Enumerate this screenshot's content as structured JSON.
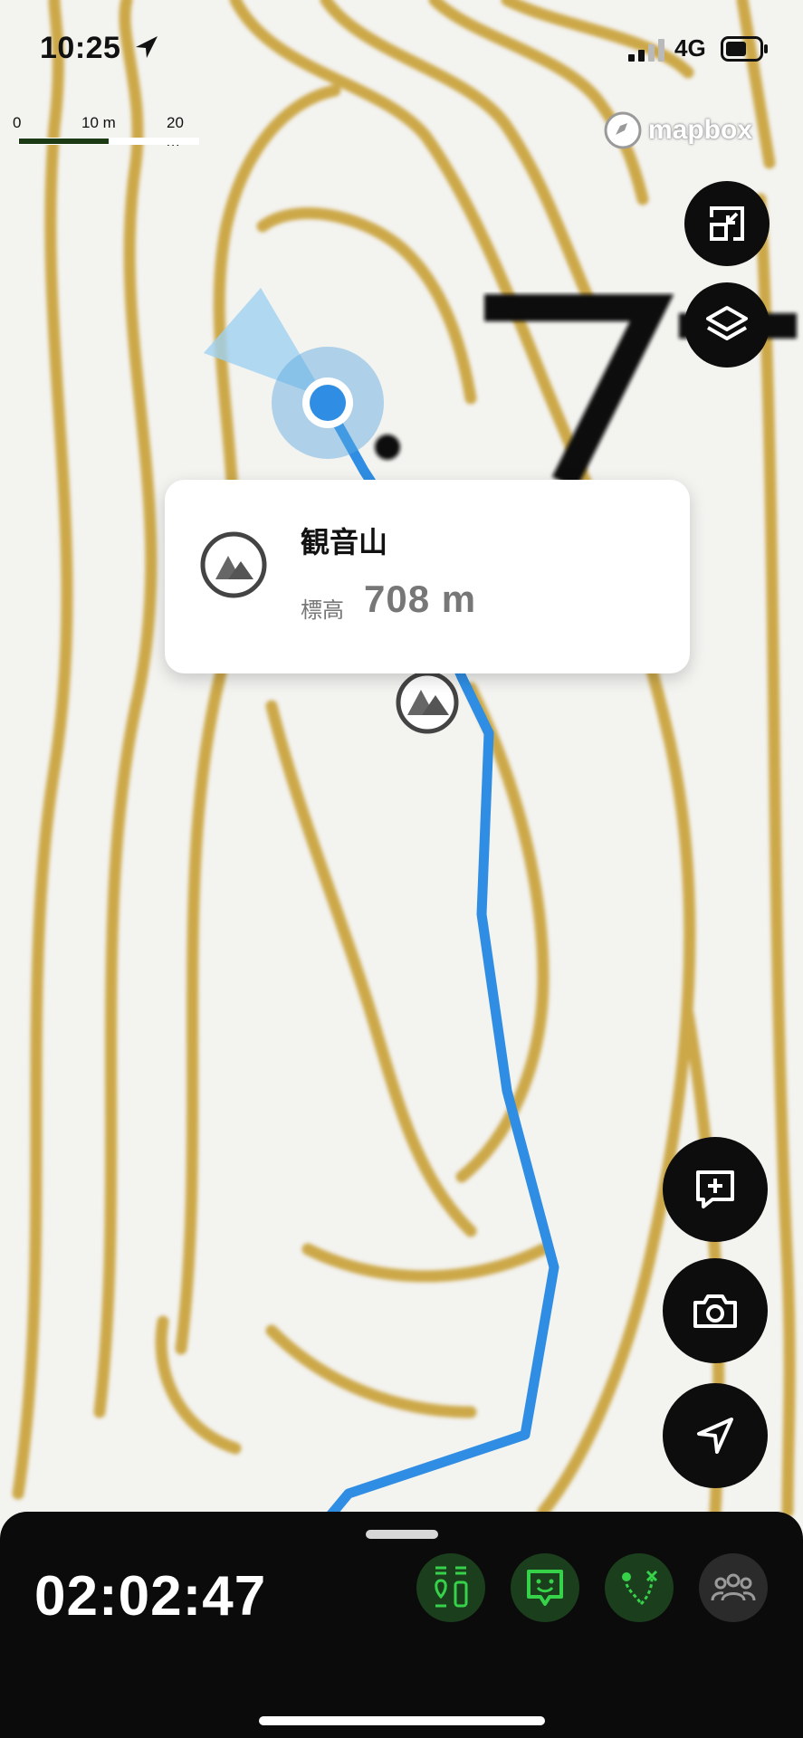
{
  "status_bar": {
    "time": "10:25",
    "network": "4G"
  },
  "map": {
    "scale": {
      "labels": [
        "0",
        "10 m",
        "20 m"
      ]
    },
    "attribution": "mapbox",
    "contour_label": "7"
  },
  "right_controls": {
    "top": [
      {
        "name": "expand-map-button",
        "icon": "expand-square-icon"
      },
      {
        "name": "layers-button",
        "icon": "layers-icon"
      }
    ],
    "bottom": [
      {
        "name": "add-note-button",
        "icon": "add-note-icon"
      },
      {
        "name": "camera-button",
        "icon": "camera-icon"
      },
      {
        "name": "locate-button",
        "icon": "navigation-arrow-icon"
      }
    ]
  },
  "poi_popup": {
    "name": "観音山",
    "elevation_label": "標高",
    "elevation_value": "708 m",
    "icon": "mountain-icon"
  },
  "bottom_panel": {
    "elapsed_time": "02:02:47",
    "buttons": [
      {
        "name": "waypoints-button",
        "icon": "waypoints-icon",
        "color": "#36d24a"
      },
      {
        "name": "chat-button",
        "icon": "chat-face-icon",
        "color": "#36d24a"
      },
      {
        "name": "route-button",
        "icon": "route-icon",
        "color": "#36d24a"
      },
      {
        "name": "group-button",
        "icon": "group-icon",
        "color": "#9a9a9a"
      }
    ]
  },
  "colors": {
    "track": "#2f8ee3",
    "contour": "#c9a23a",
    "accent_green": "#2fa83a"
  }
}
